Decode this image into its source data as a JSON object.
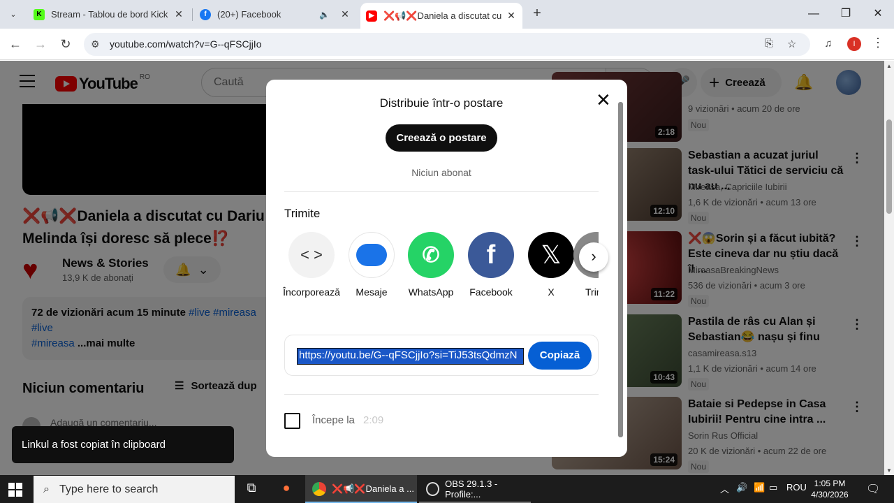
{
  "browser": {
    "tabs": [
      {
        "title": "Stream - Tablou de bord Kick",
        "favicon": "kick-icon",
        "color": "#53fc18"
      },
      {
        "title": "(20+) Facebook",
        "favicon": "facebook-icon",
        "color": "#1877f2"
      },
      {
        "title": "❌📢❌Daniela a discutat cu",
        "favicon": "youtube-icon",
        "color": "#ff0000"
      }
    ],
    "url": "youtube.com/watch?v=G--qFSCjjIo",
    "profile_initial": "I"
  },
  "youtube": {
    "logo_text": "YouTube",
    "country_code": "RO",
    "search_placeholder": "Caută",
    "create_label": "Creează",
    "video_title": "❌📢❌Daniela a discutat cu Dariu Melinda își doresc să plece⁉️",
    "video_title_line1": "❌📢❌Daniela a discutat cu Dariu",
    "video_title_line2": "Melinda își doresc să plece⁉️",
    "channel_name": "News & Stories",
    "channel_subs": "13,9 K de abonați",
    "desc_meta": "72 de vizionări  acum 15 minute",
    "desc_tags_line1": "#live #mireasa",
    "desc_tag_live": "#live",
    "desc_tag_mireasa": "#mireasa",
    "desc_more": "...mai multe",
    "comments_header": "Niciun comentariu",
    "sort_label": "Sortează dup",
    "add_comment": "Adaugă un comentariu..."
  },
  "recommendations": [
    {
      "title": "",
      "channel": "",
      "views": "9 vizionări • acum 20 de ore",
      "badge": "Nou",
      "duration": "2:18"
    },
    {
      "title": "Sebastian a acuzat juriul task-ului Tătici de serviciu că nu au ...",
      "channel": "Mireasa, Capriciile Iubirii",
      "views": "1,6 K de vizionări • acum 13 ore",
      "badge": "Nou",
      "duration": "12:10"
    },
    {
      "title": "❌😱Sorin și a făcut iubită? Este cineva dar nu știu dacă îl ...",
      "channel": "MireasaBreakingNews",
      "views": "536 de vizionări • acum 3 ore",
      "badge": "Nou",
      "duration": "11:22"
    },
    {
      "title": "Pastila de râs cu Alan și Sebastian😂 nașu și finu",
      "channel": "casamireasa.s13",
      "views": "1,1 K de vizionări • acum 14 ore",
      "badge": "Nou",
      "duration": "10:43"
    },
    {
      "title": "Bataie si Pedepse in Casa Iubirii! Pentru cine intra ...",
      "channel": "Sorin Rus Official",
      "views": "20 K de vizionări • acum 22 de ore",
      "badge": "Nou",
      "duration": "15:24"
    }
  ],
  "share_dialog": {
    "title": "Distribuie într-o postare",
    "create_post": "Creează o postare",
    "no_subscribers": "Niciun abonat",
    "send_header": "Trimite",
    "targets": [
      {
        "label": "Încorporează",
        "icon": "embed-icon",
        "color": "#f2f2f2"
      },
      {
        "label": "Mesaje",
        "icon": "messages-icon",
        "color": "#ffffff"
      },
      {
        "label": "WhatsApp",
        "icon": "whatsapp-icon",
        "color": "#25d366"
      },
      {
        "label": "Facebook",
        "icon": "facebook-icon",
        "color": "#3b5998"
      },
      {
        "label": "X",
        "icon": "x-icon",
        "color": "#000000"
      },
      {
        "label": "Trin",
        "icon": "email-icon",
        "color": "#888888"
      }
    ],
    "share_url": "https://youtu.be/G--qFSCjjIo?si=TiJ53tsQdmzN",
    "copy_label": "Copiază",
    "start_at_label": "Începe la",
    "start_time": "2:09"
  },
  "toast": "Linkul a fost copiat în clipboard",
  "taskbar": {
    "search_placeholder": "Type here to search",
    "apps": [
      {
        "label": "❌📢❌Daniela a ..."
      },
      {
        "label": "OBS 29.1.3 - Profile:..."
      }
    ],
    "language": "ROU",
    "time": "1:05 PM",
    "date": "4/30/2026"
  }
}
